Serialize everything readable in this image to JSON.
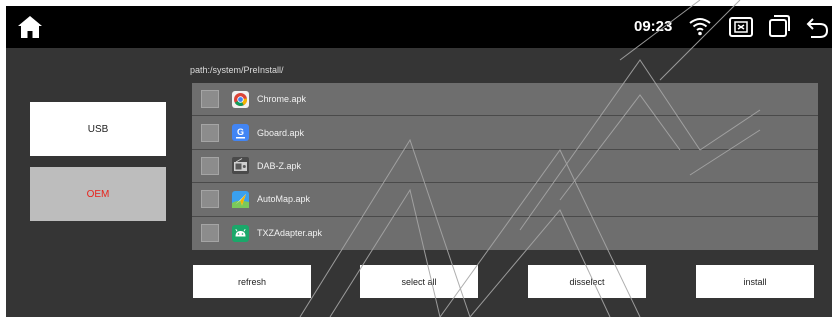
{
  "status_bar": {
    "time": "09:23",
    "icons": [
      "home-icon",
      "wifi-icon",
      "close-apps-icon",
      "recent-apps-icon",
      "back-icon"
    ]
  },
  "path_label": "path:/system/PreInstall/",
  "sources": {
    "usb_label": "USB",
    "oem_label": "OEM",
    "selected": "OEM",
    "selected_color": "#e8231c"
  },
  "files": [
    {
      "name": "Chrome.apk",
      "icon": "chrome-icon"
    },
    {
      "name": "Gboard.apk",
      "icon": "gboard-icon"
    },
    {
      "name": "DAB-Z.apk",
      "icon": "dab-radio-icon"
    },
    {
      "name": "AutoMap.apk",
      "icon": "automap-icon"
    },
    {
      "name": "TXZAdapter.apk",
      "icon": "android-icon"
    }
  ],
  "actions": {
    "refresh_label": "refresh",
    "select_all_label": "select all",
    "disselect_label": "disselect",
    "install_label": "install"
  }
}
